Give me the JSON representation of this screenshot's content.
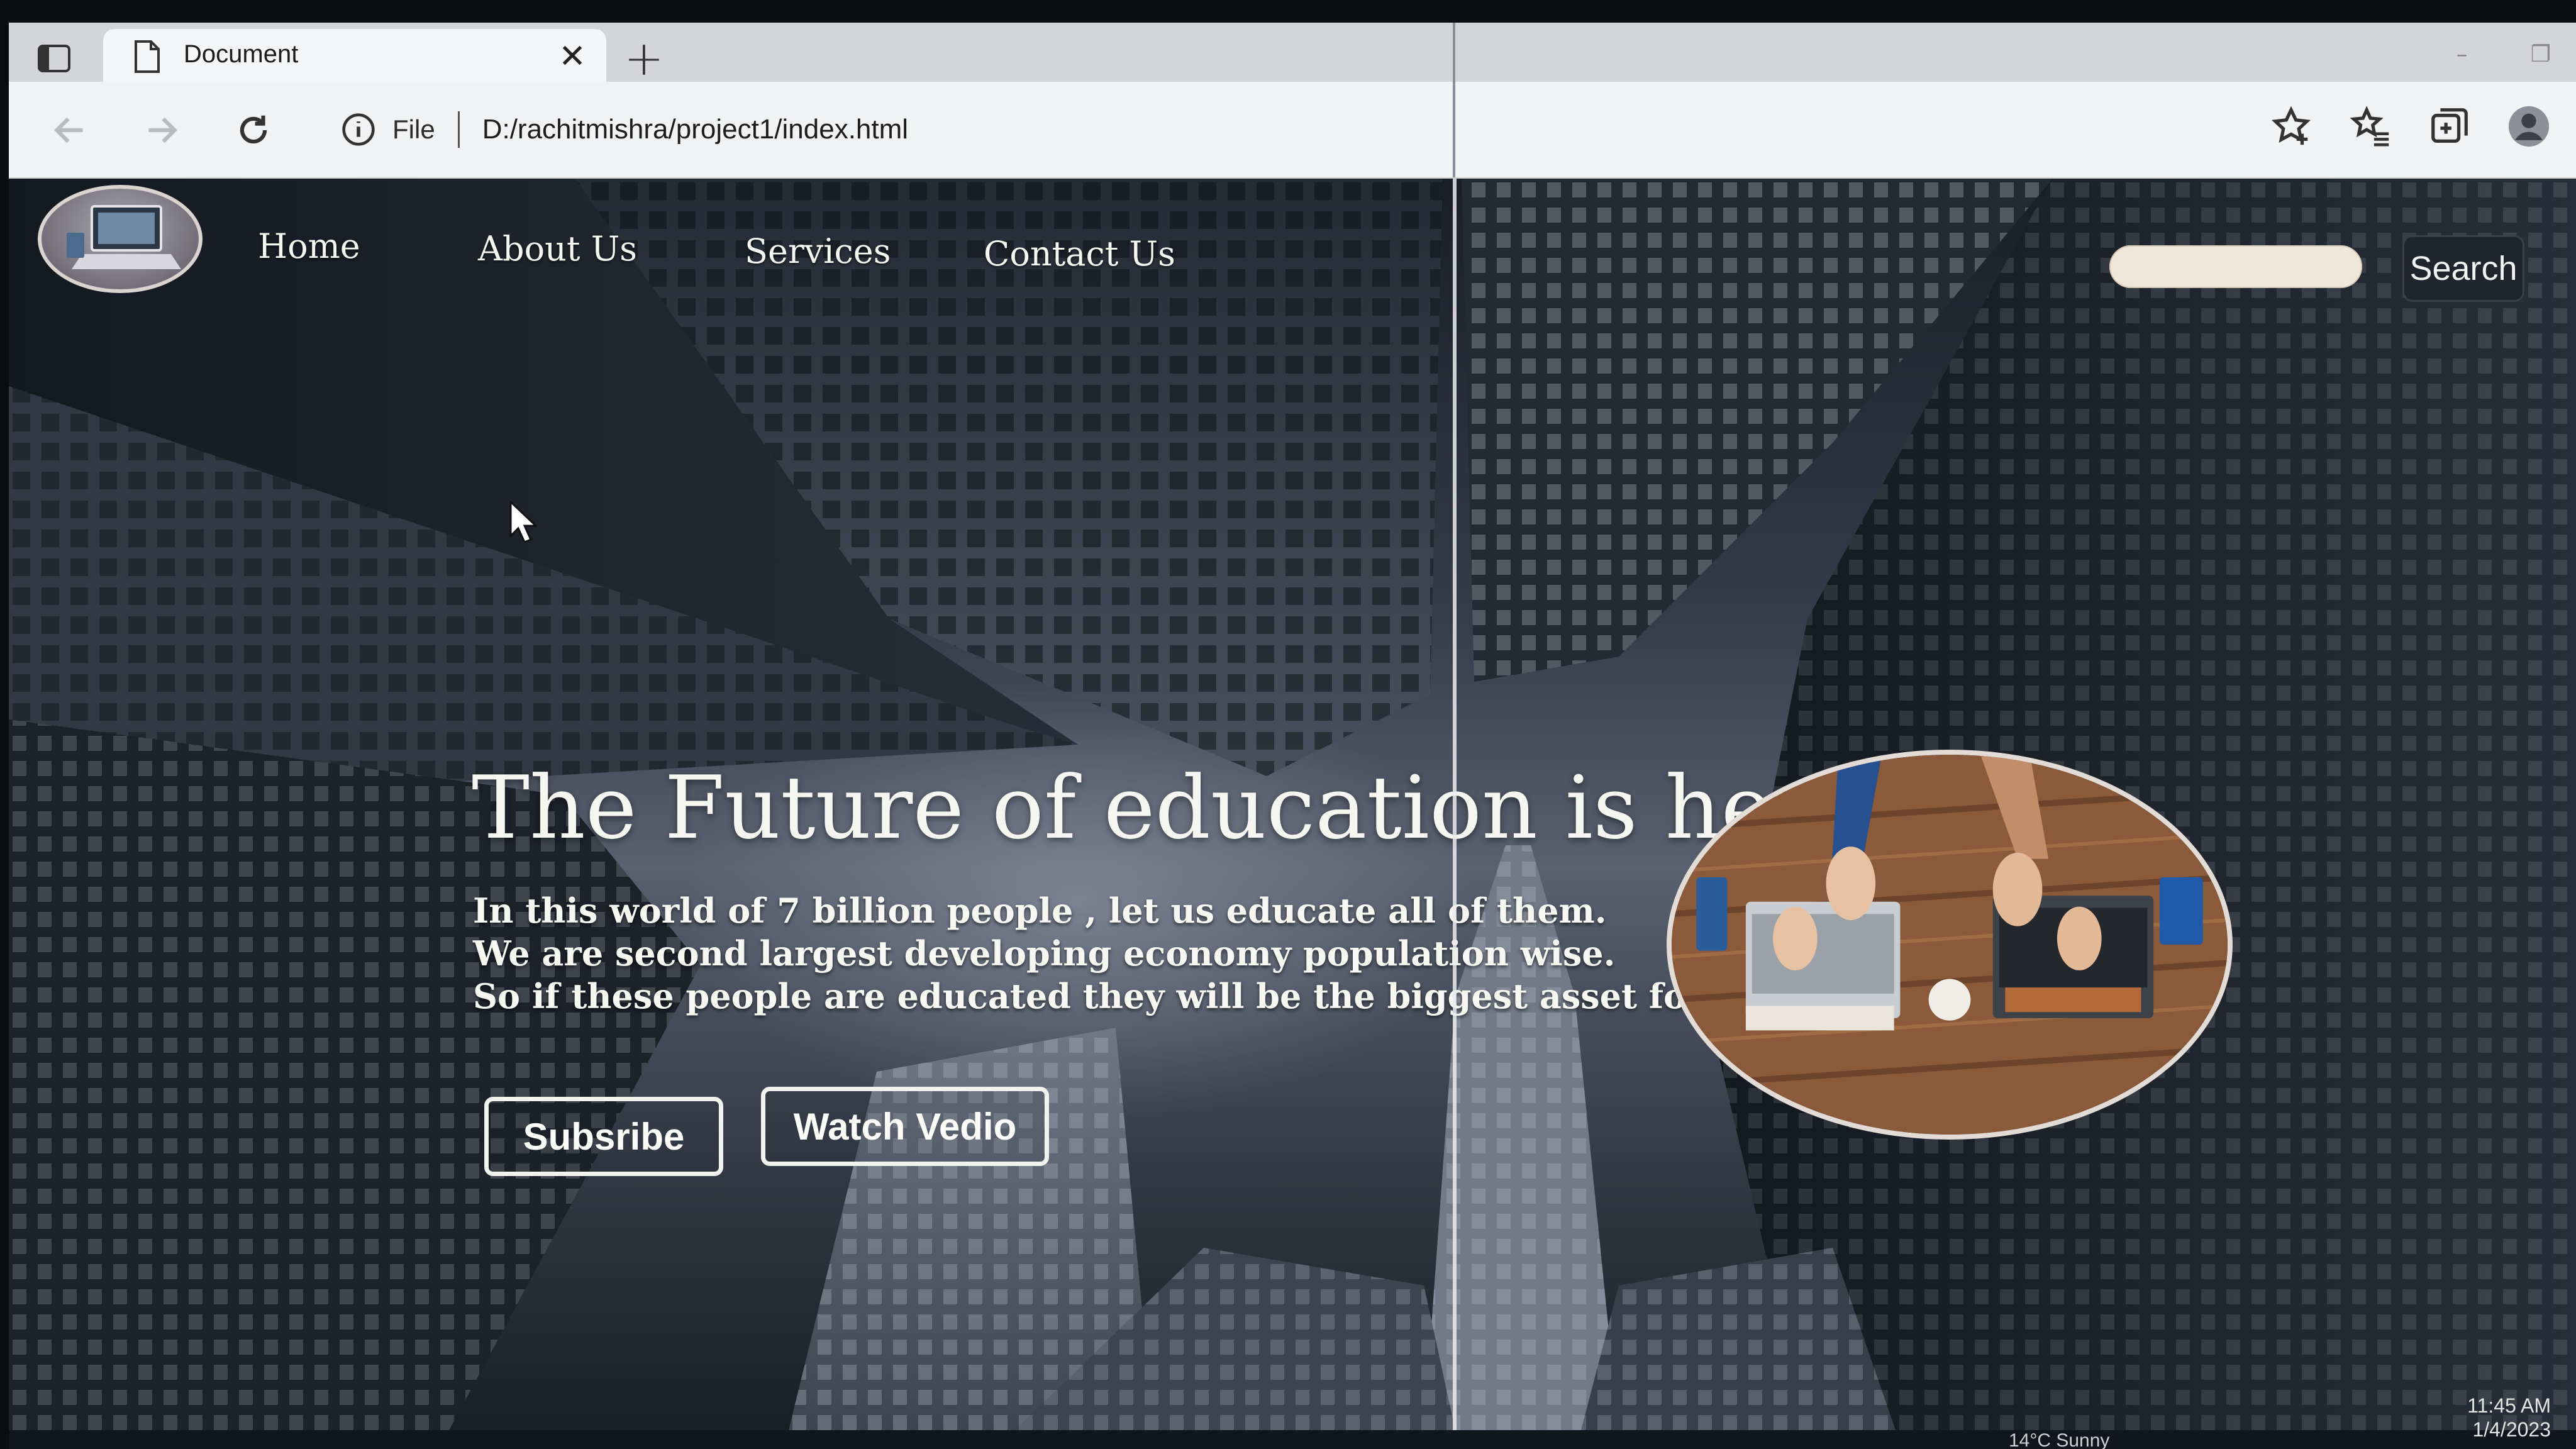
{
  "browser": {
    "tab_title": "Document",
    "address_scheme": "File",
    "address_url": "D:/rachitmishra/project1/index.html"
  },
  "nav": {
    "items": [
      "Home",
      "About Us",
      "Services",
      "Contact Us"
    ],
    "search_button": "Search",
    "search_placeholder": ""
  },
  "hero": {
    "title": "The Future of education is here.",
    "lines": [
      "In this world of 7 billion people , let us educate all of them.",
      "We are second largest developing economy population wise.",
      "So if these people are educated they will be the biggest asset for our country."
    ],
    "buttons": {
      "subscribe": "Subsribe",
      "watch": "Watch Vedio"
    }
  },
  "taskbar": {
    "weather": "14°C Sunny",
    "time": "11:45 AM",
    "date": "1/4/2023"
  },
  "icons": {
    "tab_actions": "tab-actions-icon",
    "page": "page-icon",
    "close": "close-icon",
    "new_tab": "plus-icon",
    "back": "back-arrow-icon",
    "forward": "forward-arrow-icon",
    "refresh": "refresh-icon",
    "info": "info-icon",
    "favorite_add": "star-plus-icon",
    "favorites": "favorites-icon",
    "collections": "collections-icon",
    "profile": "profile-icon"
  }
}
